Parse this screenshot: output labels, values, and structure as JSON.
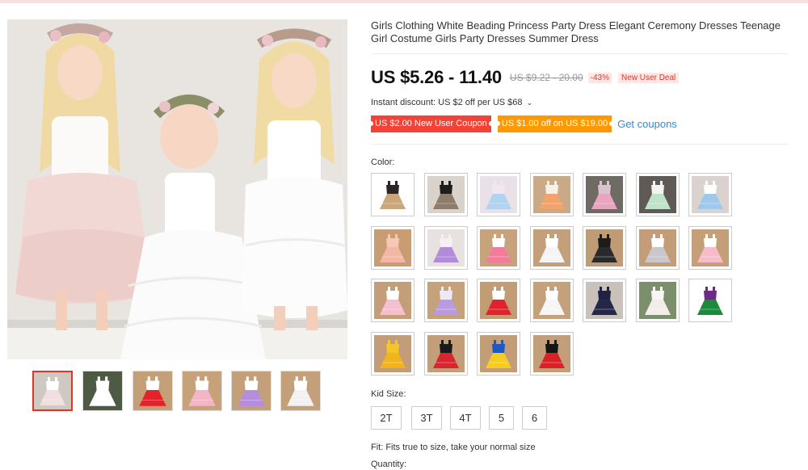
{
  "product": {
    "title": "Girls Clothing White Beading Princess Party Dress Elegant Ceremony Dresses Teenage Girl Costume Girls Party Dresses Summer Dress",
    "price_current": "US $5.26 - 11.40",
    "price_original": "US $9.22 - 20.00",
    "discount": "-43%",
    "deal_badge": "New User Deal",
    "instant_discount": "Instant discount: US $2 off per US $68",
    "instant_chevron": "⌄"
  },
  "coupons": {
    "red": "US $2.00 New User Coupon",
    "orange": "US $1.00 off on US $19.00",
    "link": "Get coupons"
  },
  "color": {
    "label": "Color:",
    "swatches": [
      {
        "name": "black-tan-tiered-dress",
        "dress": "#2b2623",
        "skirt": "#caa67c",
        "bg": "#ffffff"
      },
      {
        "name": "black-leopard-dress",
        "dress": "#1e1e1e",
        "skirt": "#8d7b6b",
        "bg": "#d9d3cc"
      },
      {
        "name": "rainbow-heart-dress",
        "dress": "#f3e6ef",
        "skirt": "#b1d3ef",
        "bg": "#e8e1e8"
      },
      {
        "name": "rainbow-striped-dress",
        "dress": "#f4f0ec",
        "skirt": "#f2a36b",
        "bg": "#c9a986"
      },
      {
        "name": "pink-grey-tutu-dress",
        "dress": "#d9c3cf",
        "skirt": "#e9a4bf",
        "bg": "#6f6a64"
      },
      {
        "name": "unicorn-rainbow-tutu",
        "dress": "#f3f3f3",
        "skirt": "#bfe3c8",
        "bg": "#5f5a55"
      },
      {
        "name": "unicorn-pastel-dress",
        "dress": "#ffffff",
        "skirt": "#9ec9ea",
        "bg": "#d9d2ce"
      },
      {
        "name": "peach-flower-dress",
        "dress": "#f7c8b4",
        "skirt": "#f4b7a6",
        "bg": "#c89d73"
      },
      {
        "name": "purple-pink-tutu",
        "dress": "#f6f0f6",
        "skirt": "#b38cd9",
        "bg": "#e7e2e0"
      },
      {
        "name": "rainbow-tutu-dress",
        "dress": "#ffffff",
        "skirt": "#f27d9a",
        "bg": "#c7a27c"
      },
      {
        "name": "white-lace-tutu",
        "dress": "#ffffff",
        "skirt": "#f4f4f4",
        "bg": "#c3a07a"
      },
      {
        "name": "black-floral-dress",
        "dress": "#1c1c1c",
        "skirt": "#2a2a2a",
        "bg": "#c09c76"
      },
      {
        "name": "grey-unicorn-tutu",
        "dress": "#ffffff",
        "skirt": "#c8c8cc",
        "bg": "#c29d77"
      },
      {
        "name": "pink-floral-tutu",
        "dress": "#ffffff",
        "skirt": "#f6bcc8",
        "bg": "#c49f78"
      },
      {
        "name": "pink-rose-tutu",
        "dress": "#ffffff",
        "skirt": "#f5bfd0",
        "bg": "#c39e78"
      },
      {
        "name": "lavender-tutu",
        "dress": "#efe8f5",
        "skirt": "#b89be0",
        "bg": "#c6a27b"
      },
      {
        "name": "red-white-tutu",
        "dress": "#ffffff",
        "skirt": "#e0232b",
        "bg": "#c29c75"
      },
      {
        "name": "white-layered-tutu",
        "dress": "#ffffff",
        "skirt": "#f6f6f6",
        "bg": "#c5a17b"
      },
      {
        "name": "navy-star-dress",
        "dress": "#1f2240",
        "skirt": "#242748",
        "bg": "#c8c2bb"
      },
      {
        "name": "white-cherry-dress",
        "dress": "#f8f5f2",
        "skirt": "#f2ede8",
        "bg": "#7b8f6d"
      },
      {
        "name": "green-princess-dress",
        "dress": "#6c2a86",
        "skirt": "#1b8a3a",
        "bg": "#ffffff"
      },
      {
        "name": "yellow-belle-dress",
        "dress": "#f4c52d",
        "skirt": "#f2b41c",
        "bg": "#c29d77"
      },
      {
        "name": "red-polka-dot-dress",
        "dress": "#1a1a1a",
        "skirt": "#d7262f",
        "bg": "#c39e78"
      },
      {
        "name": "snow-white-dress",
        "dress": "#1f57c3",
        "skirt": "#f6cc1e",
        "bg": "#c29d77"
      },
      {
        "name": "minnie-red-dress",
        "dress": "#151515",
        "skirt": "#da2128",
        "bg": "#c39e78"
      }
    ]
  },
  "size": {
    "label": "Kid Size:",
    "options": [
      "2T",
      "3T",
      "4T",
      "5",
      "6"
    ]
  },
  "fit": "Fit: Fits true to size, take your normal size",
  "quantity_label": "Quantity:",
  "gallery": {
    "thumbnails": [
      {
        "name": "thumb-three-girls",
        "dress": "#ffffff",
        "skirt": "#f1dfe0",
        "bg": "#cfc9c3"
      },
      {
        "name": "thumb-garden",
        "dress": "#ffffff",
        "skirt": "#ffffff",
        "bg": "#4e5a43"
      },
      {
        "name": "thumb-red-tutu",
        "dress": "#ffffff",
        "skirt": "#e1242b",
        "bg": "#c49f78"
      },
      {
        "name": "thumb-pink-tutu",
        "dress": "#ffffff",
        "skirt": "#f3b6c6",
        "bg": "#c6a17a"
      },
      {
        "name": "thumb-purple-tutu",
        "dress": "#ffffff",
        "skirt": "#b48ddc",
        "bg": "#c4a07a"
      },
      {
        "name": "thumb-white-tutu",
        "dress": "#ffffff",
        "skirt": "#f2f2f2",
        "bg": "#c4a07a"
      }
    ]
  },
  "colors": {
    "accent_red": "#e43225",
    "coupon_red": "#f44336",
    "coupon_orange": "#ff9900",
    "link_blue": "#2e8bd8"
  }
}
